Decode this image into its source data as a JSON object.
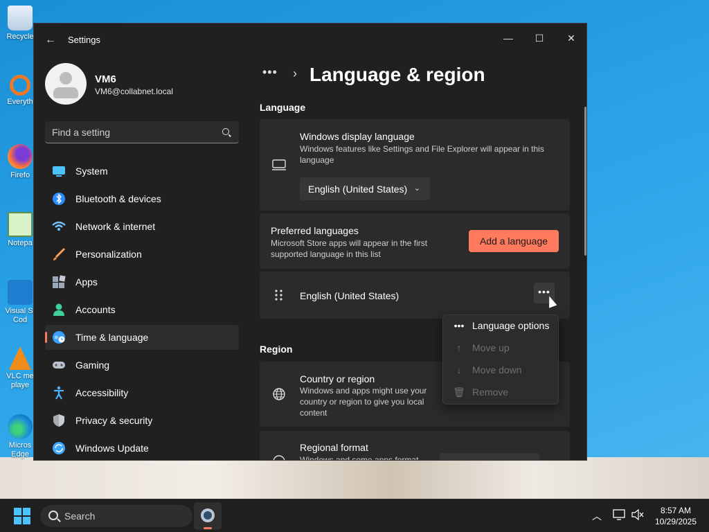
{
  "desktop": {
    "icons": [
      {
        "label": "Recycle",
        "icon": "recycle-bin-icon"
      },
      {
        "label": "Everyth",
        "icon": "everything-search-icon"
      },
      {
        "label": "Firefo",
        "icon": "firefox-icon"
      },
      {
        "label": "Notepa",
        "icon": "notepad-icon"
      },
      {
        "label": "Visual St Cod",
        "icon": "vscode-icon"
      },
      {
        "label": "VLC me playe",
        "icon": "vlc-icon"
      },
      {
        "label": "Micros Edge",
        "icon": "edge-icon"
      }
    ]
  },
  "window": {
    "title": "Settings",
    "controls": {
      "minimize": "—",
      "maximize": "☐",
      "close": "✕"
    }
  },
  "user": {
    "name": "VM6",
    "email": "VM6@collabnet.local"
  },
  "search": {
    "placeholder": "Find a setting"
  },
  "sidebar": {
    "items": [
      {
        "label": "System",
        "icon": "system-display-icon",
        "color": "#4cc2ff"
      },
      {
        "label": "Bluetooth & devices",
        "icon": "bluetooth-icon",
        "color": "#2d8cff"
      },
      {
        "label": "Network & internet",
        "icon": "wifi-icon",
        "color": "#6fc3ff"
      },
      {
        "label": "Personalization",
        "icon": "paintbrush-icon",
        "color": "#f5a15b"
      },
      {
        "label": "Apps",
        "icon": "apps-icon",
        "color": "#9aa7b8"
      },
      {
        "label": "Accounts",
        "icon": "accounts-icon",
        "color": "#3fcf9a"
      },
      {
        "label": "Time & language",
        "icon": "globe-clock-icon",
        "color": "#3aa0ff",
        "active": true
      },
      {
        "label": "Gaming",
        "icon": "gamepad-icon",
        "color": "#b9c3cf"
      },
      {
        "label": "Accessibility",
        "icon": "accessibility-icon",
        "color": "#4cb4ff"
      },
      {
        "label": "Privacy & security",
        "icon": "shield-icon",
        "color": "#a7aab0"
      },
      {
        "label": "Windows Update",
        "icon": "windows-update-icon",
        "color": "#3ea6ff"
      }
    ]
  },
  "main": {
    "breadcrumb_more": "•••",
    "page_title": "Language & region",
    "language_section": "Language",
    "display_language": {
      "title": "Windows display language",
      "desc": "Windows features like Settings and File Explorer will appear in this language",
      "value": "English (United States)"
    },
    "preferred": {
      "title": "Preferred languages",
      "desc": "Microsoft Store apps will appear in the first supported language in this list",
      "add_button": "Add a language",
      "languages": [
        {
          "label": "English (United States)"
        }
      ],
      "more_button": "•••"
    },
    "region_section": "Region",
    "country": {
      "title": "Country or region",
      "desc": "Windows and apps might use your country or region to give you local content"
    },
    "regional_format": {
      "title": "Regional format",
      "desc": "Windows and some apps format"
    }
  },
  "context_menu": {
    "items": [
      {
        "label": "Language options",
        "icon": "more-dots-icon",
        "enabled": true
      },
      {
        "label": "Move up",
        "icon": "arrow-up-icon",
        "enabled": false
      },
      {
        "label": "Move down",
        "icon": "arrow-down-icon",
        "enabled": false
      },
      {
        "label": "Remove",
        "icon": "trash-icon",
        "enabled": false
      }
    ]
  },
  "taskbar": {
    "search_label": "Search",
    "time": "8:57 AM",
    "date": "10/29/2025"
  },
  "colors": {
    "accent": "#ff7a5c",
    "window_bg": "#202020",
    "card_bg": "#2b2b2b"
  }
}
